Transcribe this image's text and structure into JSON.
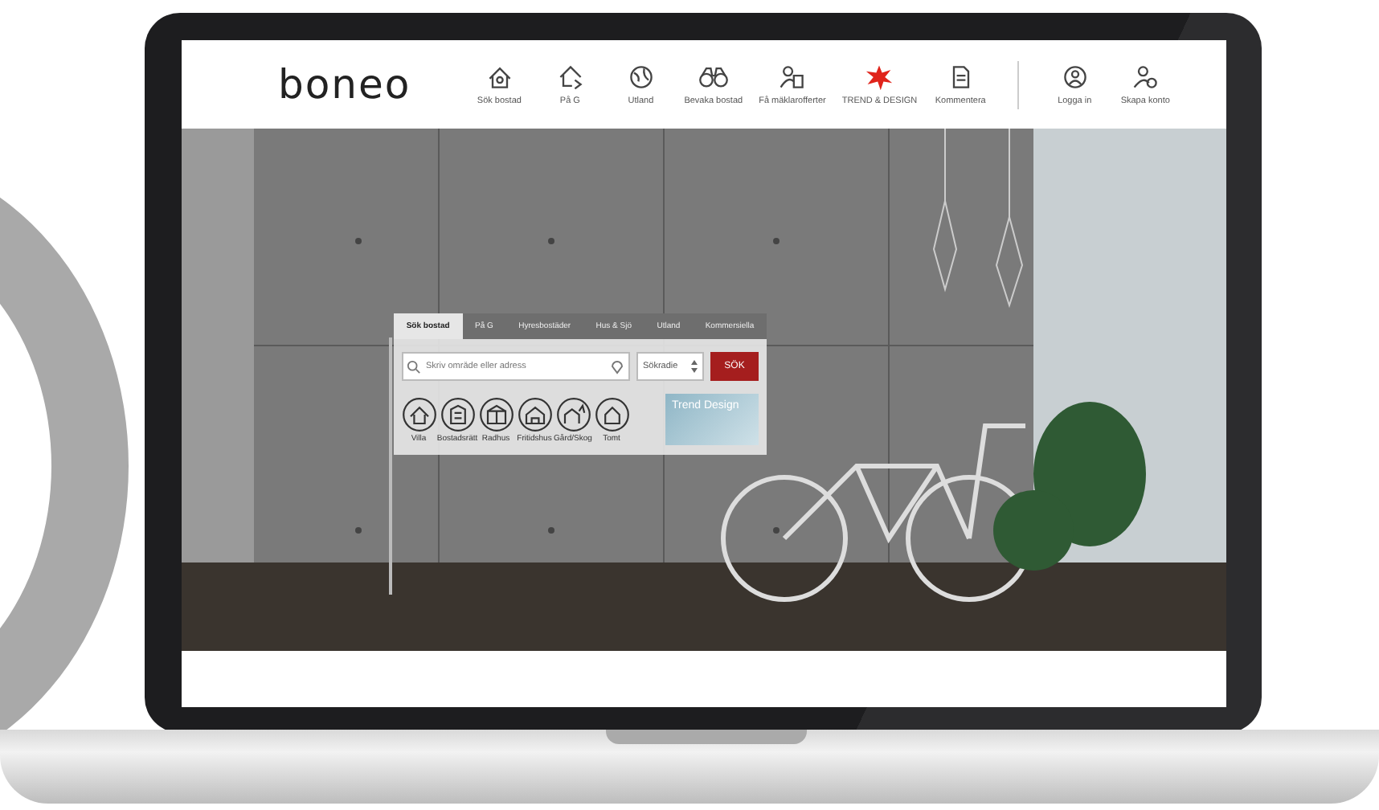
{
  "logo": "boneo",
  "nav": [
    {
      "label": "Sök bostad",
      "kind": "normal"
    },
    {
      "label": "På G",
      "kind": "normal"
    },
    {
      "label": "Utland",
      "kind": "normal"
    },
    {
      "label": "Bevaka bostad",
      "kind": "normal"
    },
    {
      "label": "Få mäklarofferter",
      "kind": "normal"
    },
    {
      "label": "TREND & DESIGN",
      "kind": "highlight"
    },
    {
      "label": "Kommentera",
      "kind": "normal"
    }
  ],
  "account": [
    {
      "label": "Logga in"
    },
    {
      "label": "Skapa konto"
    }
  ],
  "search_panel": {
    "tabs": [
      {
        "label": "Sök bostad",
        "selected": true
      },
      {
        "label": "På G",
        "selected": false
      },
      {
        "label": "Hyresbostäder",
        "selected": false
      },
      {
        "label": "Hus & Sjö",
        "selected": false
      },
      {
        "label": "Utland",
        "selected": false
      },
      {
        "label": "Kommersiella",
        "selected": false
      }
    ],
    "search": {
      "placeholder": "Skriv område eller adress"
    },
    "radius": {
      "value": "Sökradie"
    },
    "button": "SÖK",
    "types": [
      {
        "label": "Villa"
      },
      {
        "label": "Bostadsrätt"
      },
      {
        "label": "Radhus"
      },
      {
        "label": "Fritidshus"
      },
      {
        "label": "Gård/Skog"
      },
      {
        "label": "Tomt"
      }
    ],
    "banner": "Trend Design"
  }
}
